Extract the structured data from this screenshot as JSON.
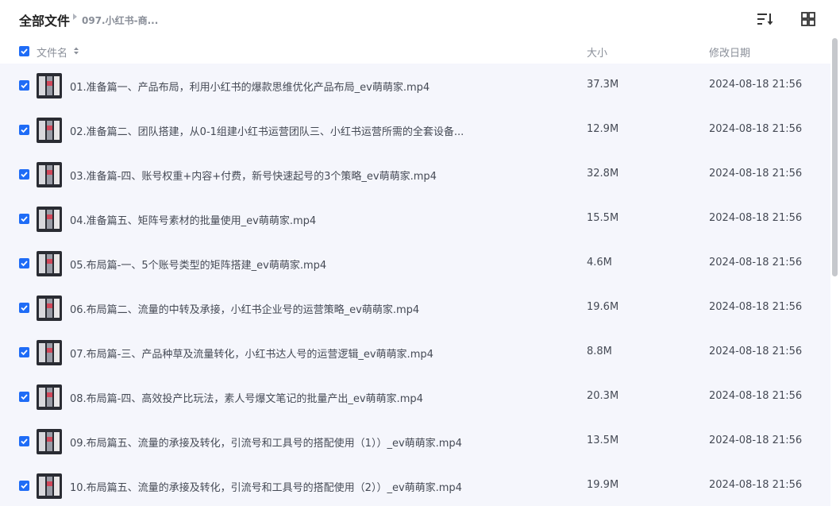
{
  "breadcrumb": {
    "root": "全部文件",
    "current": "097.小红书-商..."
  },
  "toolbar": {
    "sort_icon": "sort-list-icon",
    "view_icon": "grid-view-icon"
  },
  "columns": {
    "name": "文件名",
    "size": "大小",
    "date": "修改日期"
  },
  "colors": {
    "accent": "#1f6cf6",
    "row_bg": "#f5f6fc"
  },
  "files": [
    {
      "name": "01.准备篇一、产品布局，利用小红书的爆款思维优化产品布局_ev萌萌家.mp4",
      "size": "37.3M",
      "date": "2024-08-18 21:56"
    },
    {
      "name": "02.准备篇二、团队搭建，从0-1组建小红书运营团队三、小红书运营所需的全套设备...",
      "size": "12.9M",
      "date": "2024-08-18 21:56"
    },
    {
      "name": "03.准备篇-四、账号权重+内容+付费，新号快速起号的3个策略_ev萌萌家.mp4",
      "size": "32.8M",
      "date": "2024-08-18 21:56"
    },
    {
      "name": "04.准备篇五、矩阵号素材的批量使用_ev萌萌家.mp4",
      "size": "15.5M",
      "date": "2024-08-18 21:56"
    },
    {
      "name": "05.布局篇-一、5个账号类型的矩阵搭建_ev萌萌家.mp4",
      "size": "4.6M",
      "date": "2024-08-18 21:56"
    },
    {
      "name": "06.布局篇二、流量的中转及承接，小红书企业号的运营策略_ev萌萌家.mp4",
      "size": "19.6M",
      "date": "2024-08-18 21:56"
    },
    {
      "name": "07.布局篇-三、产品种草及流量转化，小红书达人号的运营逻辑_ev萌萌家.mp4",
      "size": "8.8M",
      "date": "2024-08-18 21:56"
    },
    {
      "name": "08.布局篇-四、高效投产比玩法，素人号爆文笔记的批量产出_ev萌萌家.mp4",
      "size": "20.3M",
      "date": "2024-08-18 21:56"
    },
    {
      "name": "09.布局篇五、流量的承接及转化，引流号和工具号的搭配使用（1））_ev萌萌家.mp4",
      "size": "13.5M",
      "date": "2024-08-18 21:56"
    },
    {
      "name": "10.布局篇五、流量的承接及转化，引流号和工具号的搭配使用（2））_ev萌萌家.mp4",
      "size": "19.9M",
      "date": "2024-08-18 21:56"
    }
  ]
}
